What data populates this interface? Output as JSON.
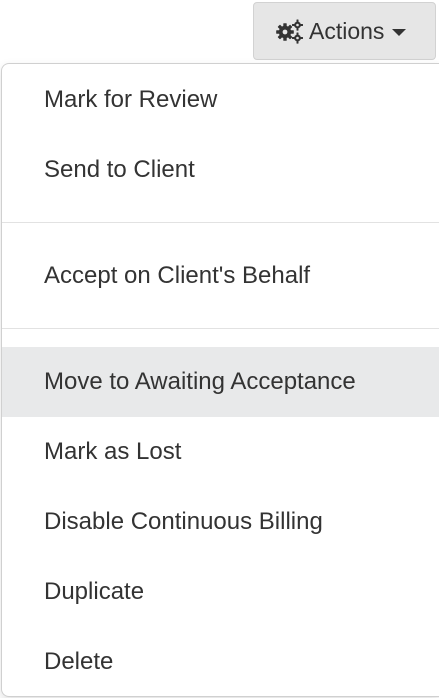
{
  "actions_button": {
    "label": "Actions",
    "icon": "cogs-icon",
    "caret_icon": "caret-down-icon"
  },
  "menu": {
    "group1": [
      {
        "label": "Mark for Review"
      },
      {
        "label": "Send to Client"
      }
    ],
    "group2": [
      {
        "label": "Accept on Client's Behalf"
      }
    ],
    "group3": [
      {
        "label": "Move to Awaiting Acceptance",
        "highlighted": true
      },
      {
        "label": "Mark as Lost"
      },
      {
        "label": "Disable Continuous Billing"
      },
      {
        "label": "Duplicate"
      },
      {
        "label": "Delete"
      }
    ]
  },
  "colors": {
    "button_bg": "#e6e6e6",
    "highlight_bg": "#e8e9ea",
    "text": "#333333",
    "divider": "#e2e2e2"
  }
}
